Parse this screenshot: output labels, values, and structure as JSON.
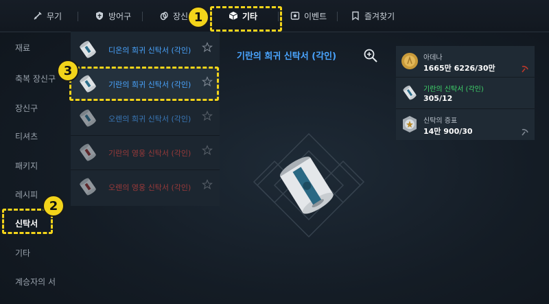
{
  "tabs": [
    {
      "label": "무기",
      "icon": "sword-icon"
    },
    {
      "label": "방어구",
      "icon": "shield-icon"
    },
    {
      "label": "장신",
      "icon": "ring-icon"
    },
    {
      "label": "기타",
      "icon": "cube-icon"
    },
    {
      "label": "이벤트",
      "icon": "event-icon"
    },
    {
      "label": "즐겨찾기",
      "icon": "bookmark-icon"
    }
  ],
  "sidebar": {
    "items": [
      {
        "label": "재료"
      },
      {
        "label": "축복 장신구"
      },
      {
        "label": "장신구"
      },
      {
        "label": "티셔츠"
      },
      {
        "label": "패키지"
      },
      {
        "label": "레시피"
      },
      {
        "label": "신탁서"
      },
      {
        "label": "기타"
      },
      {
        "label": "계승자의 서"
      }
    ]
  },
  "list": {
    "items": [
      {
        "name": "디온의 희귀 신탁서 (각인)",
        "color": "#4aa5ff",
        "ribbon": "#2d6f8c"
      },
      {
        "name": "기란의 희귀 신탁서 (각인)",
        "color": "#4aa5ff",
        "ribbon": "#2d6f8c"
      },
      {
        "name": "오렌의 희귀 신탁서 (각인)",
        "color": "#3a78b8",
        "ribbon": "#2d6f8c"
      },
      {
        "name": "기란의 영웅 신탁서 (각인)",
        "color": "#9a3a3a",
        "ribbon": "#8b2a2a"
      },
      {
        "name": "오렌의 영웅 신탁서 (각인)",
        "color": "#9a3a3a",
        "ribbon": "#8b2a2a"
      }
    ]
  },
  "detail": {
    "title": "기란의 희귀 신탁서 (각인)"
  },
  "materials": [
    {
      "name": "아데나",
      "count": "1665만 6226/30만",
      "icon": "coin-icon",
      "name_color": "#b9c1ca"
    },
    {
      "name": "기란의 신탁서 (각인)",
      "count": "305/12",
      "icon": "scroll-icon",
      "name_color": "#3fd36a"
    },
    {
      "name": "신탁의 증표",
      "count": "14만 900/30",
      "icon": "token-icon",
      "name_color": "#b9c1ca"
    }
  ],
  "annotations": [
    "1",
    "2",
    "3"
  ],
  "colors": {
    "accent": "#4aa5ff",
    "highlight": "#f3d41a"
  }
}
